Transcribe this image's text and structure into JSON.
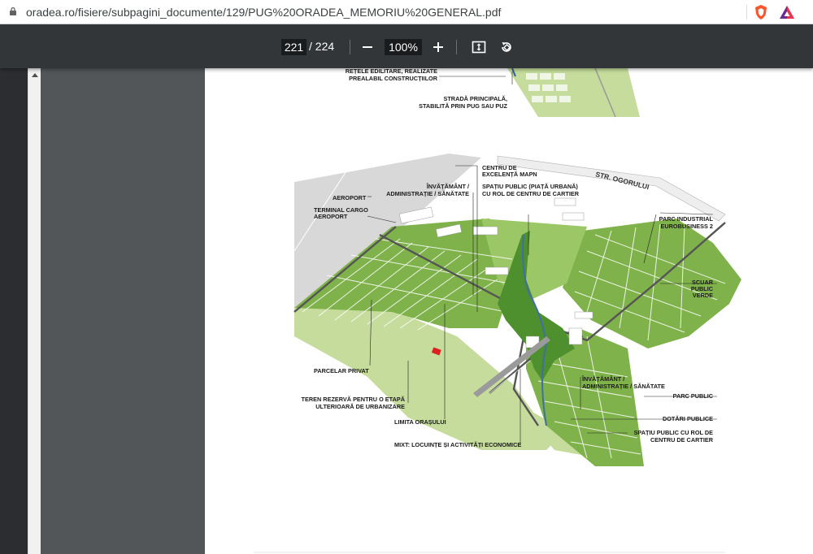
{
  "browser": {
    "url": "oradea.ro/fisiere/subpagini_documente/129/PUG%20ORADEA_MEMORIU%20GENERAL.pdf",
    "icons": [
      "lock-icon",
      "brave-shield-icon",
      "brave-rewards-icon"
    ]
  },
  "pdf_toolbar": {
    "current_page": "221",
    "page_total": "/ 224",
    "zoom": "100%",
    "icons": [
      "zoom-out-icon",
      "zoom-in-icon",
      "fit-to-page-icon",
      "rotate-icon"
    ]
  },
  "document": {
    "top_labels": {
      "retele": [
        "REȚELE EDILITARE, REALIZATE",
        "PREALABIL CONSTRUCȚIILOR"
      ],
      "strada": [
        "STRADĂ PRINCIPALĂ,",
        "STABILITĂ PRIN PUG SAU PUZ"
      ]
    },
    "labels": {
      "centru": [
        "CENTRU DE",
        "EXCELENȚĂ MAPN"
      ],
      "str_ogorului": "STR. OGORULUI",
      "aeroport": "AEROPORT",
      "invatamant_top": [
        "ÎNVĂȚĂMÂNT /",
        "ADMINISTRAȚIE /  SĂNĂTATE"
      ],
      "spatiu_public_top": [
        "SPAȚIU PUBLIC (PIAȚĂ URBANĂ)",
        "CU ROL DE CENTRU DE CARTIER"
      ],
      "terminal": [
        "TERMINAL CARGO",
        "AEROPORT"
      ],
      "parc_industrial": [
        "PARC INDUSTRIAL",
        "EUROBUSINESS 2"
      ],
      "scuar": [
        "SCUAR",
        "PUBLIC",
        "VERDE"
      ],
      "parcelar": "PARCELAR PRIVAT",
      "invatamant_bottom": [
        "ÎNVĂȚĂMÂNT /",
        "ADMINISTRAȚIE /  SĂNĂTATE"
      ],
      "parc_public": "PARC PUBLIC",
      "teren": [
        "TEREN REZERVĂ PENTRU O ETAPĂ",
        "ULTERIOARĂ DE URBANIZARE"
      ],
      "dotari": "DOTĂRI PUBLICE",
      "limita": "LIMITA ORAȘULUI",
      "spatiu_public_bottom": [
        "SPAȚIU PUBLIC CU ROL DE",
        "CENTRU DE CARTIER"
      ],
      "mixt": "MIXT: LOCUINȚE ȘI ACTIVITĂȚI ECONOMICE"
    }
  },
  "colors": {
    "toolbar": "#323639",
    "viewer_bg": "#525659",
    "field_green": "#c5dc9c",
    "block_green": "#7fb24a",
    "park_green": "#4e8f2e",
    "airport_gray": "#d8d8d8",
    "water": "#3f6fa8",
    "marker_red": "#e02020"
  }
}
